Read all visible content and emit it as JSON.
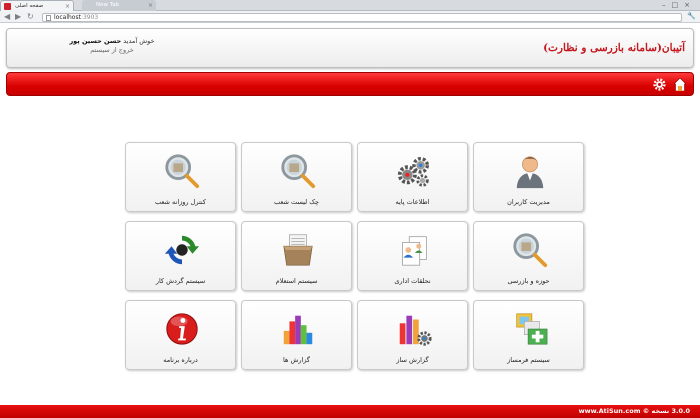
{
  "browser": {
    "tabs": [
      {
        "label": "صفحه اصلی",
        "active": true
      },
      {
        "label": "New Tab",
        "active": false
      }
    ],
    "url_host": "localhost",
    "url_port": ":3903"
  },
  "header": {
    "app_title": "آتیبان(سامانه بازرسی و نظارت)",
    "welcome_prefix": "خوش آمدید",
    "user_name": "حسن حسین پور",
    "logout": "خروج از سیستم"
  },
  "toolbar": {
    "icons": [
      "home-icon",
      "gear-icon"
    ]
  },
  "tiles": [
    {
      "label": "مدیریت کاربران",
      "icon": "user-icon"
    },
    {
      "label": "اطلاعات پایه",
      "icon": "gears-icon"
    },
    {
      "label": "چک لیست شعب",
      "icon": "magnifier-search-icon"
    },
    {
      "label": "کنترل روزانه شعب",
      "icon": "magnifier-search-icon"
    },
    {
      "label": "حوزه و بازرسی",
      "icon": "magnifier-search-icon"
    },
    {
      "label": "نحلقات اداری",
      "icon": "documents-icon"
    },
    {
      "label": "سیستم استعلام",
      "icon": "file-box-icon"
    },
    {
      "label": "سیستم گردش کار",
      "icon": "sync-arrows-icon"
    },
    {
      "label": "سیستم فرمساز",
      "icon": "form-builder-icon"
    },
    {
      "label": "گزارش ساز",
      "icon": "report-builder-icon"
    },
    {
      "label": "گزارش ها",
      "icon": "bar-chart-icon"
    },
    {
      "label": "درباره برنامه",
      "icon": "info-icon"
    }
  ],
  "footer": {
    "text": "3.0.0 نسخه © www.AtiSun.com"
  },
  "colors": {
    "brand_red": "#d90000",
    "title_red": "#c4161c"
  }
}
